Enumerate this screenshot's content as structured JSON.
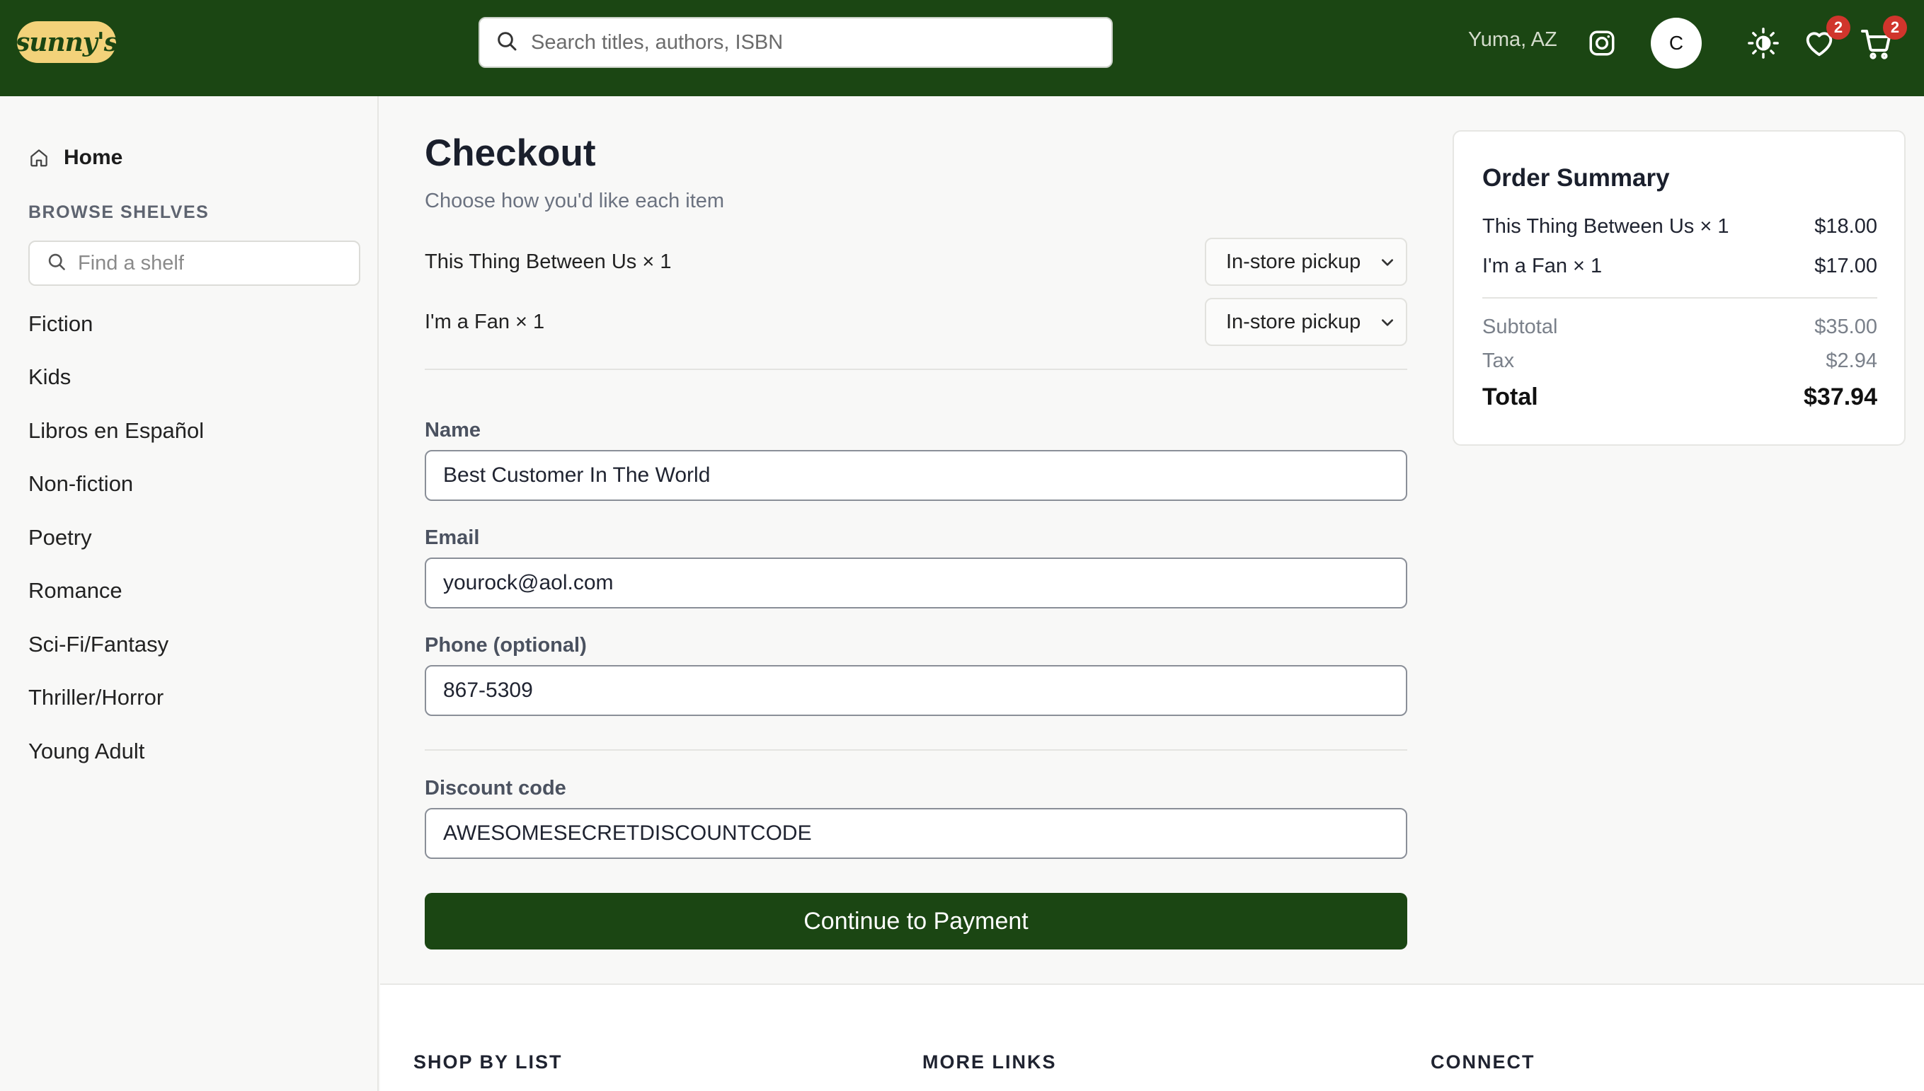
{
  "header": {
    "logo_text": "sunny's",
    "search_placeholder": "Search titles, authors, ISBN",
    "location": "Yuma, AZ",
    "avatar_initial": "C",
    "wishlist_count": "2",
    "cart_count": "2",
    "icons": [
      "search-icon",
      "instagram-icon",
      "theme-toggle-icon",
      "heart-icon",
      "cart-icon"
    ]
  },
  "sidebar": {
    "home_label": "Home",
    "browse_heading": "BROWSE SHELVES",
    "shelf_search_placeholder": "Find a shelf",
    "shelves": [
      "Fiction",
      "Kids",
      "Libros en Español",
      "Non-fiction",
      "Poetry",
      "Romance",
      "Sci-Fi/Fantasy",
      "Thriller/Horror",
      "Young Adult"
    ]
  },
  "checkout": {
    "title": "Checkout",
    "subtitle": "Choose how you'd like each item",
    "items": [
      {
        "name": "This Thing Between Us × 1",
        "fulfillment": "In-store pickup"
      },
      {
        "name": "I'm a Fan × 1",
        "fulfillment": "In-store pickup"
      }
    ],
    "name_label": "Name",
    "name_value": "Best Customer In The World",
    "email_label": "Email",
    "email_value": "yourock@aol.com",
    "phone_label": "Phone (optional)",
    "phone_value": "867-5309",
    "discount_label": "Discount code",
    "discount_value": "AWESOMESECRETDISCOUNTCODE",
    "continue_label": "Continue to Payment"
  },
  "summary": {
    "title": "Order Summary",
    "lines": [
      {
        "name": "This Thing Between Us × 1",
        "price": "$18.00"
      },
      {
        "name": "I'm a Fan × 1",
        "price": "$17.00"
      }
    ],
    "subtotal_label": "Subtotal",
    "subtotal_value": "$35.00",
    "tax_label": "Tax",
    "tax_value": "$2.94",
    "total_label": "Total",
    "total_value": "$37.94"
  },
  "footer": {
    "col1": "SHOP BY LIST",
    "col2": "MORE LINKS",
    "col3": "CONNECT"
  },
  "colors": {
    "brand_green": "#1b4613",
    "logo_yellow": "#f3d27a",
    "badge_red": "#d0352c"
  }
}
